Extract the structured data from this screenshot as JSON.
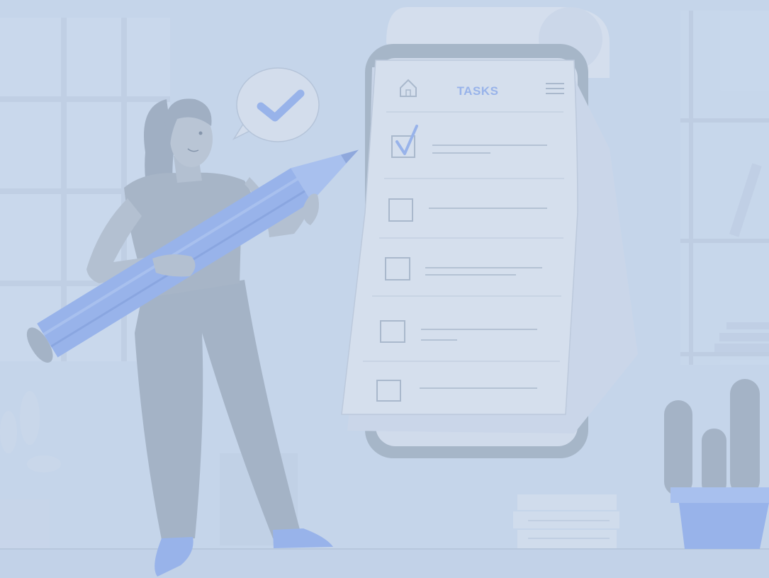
{
  "app": {
    "header": {
      "title": "TASKS",
      "home_icon": "home-icon",
      "menu_icon": "hamburger-menu-icon"
    },
    "tasks": [
      {
        "checked": true
      },
      {
        "checked": false
      },
      {
        "checked": false
      },
      {
        "checked": false
      },
      {
        "checked": false
      }
    ]
  },
  "illustration": {
    "speech_bubble_icon": "checkmark-icon",
    "held_object": "pencil",
    "decor": [
      "window",
      "bookshelf",
      "cactus-plant",
      "potted-plant",
      "book-stack"
    ]
  },
  "colors": {
    "background": "#c5d5ea",
    "accent": "#98b3ea",
    "accent_light": "#a8c0ee",
    "phone_frame": "#a6b6c8",
    "paper": "#d5dfed",
    "figure": "#a4b3c6",
    "line": "#a9b8cc"
  }
}
